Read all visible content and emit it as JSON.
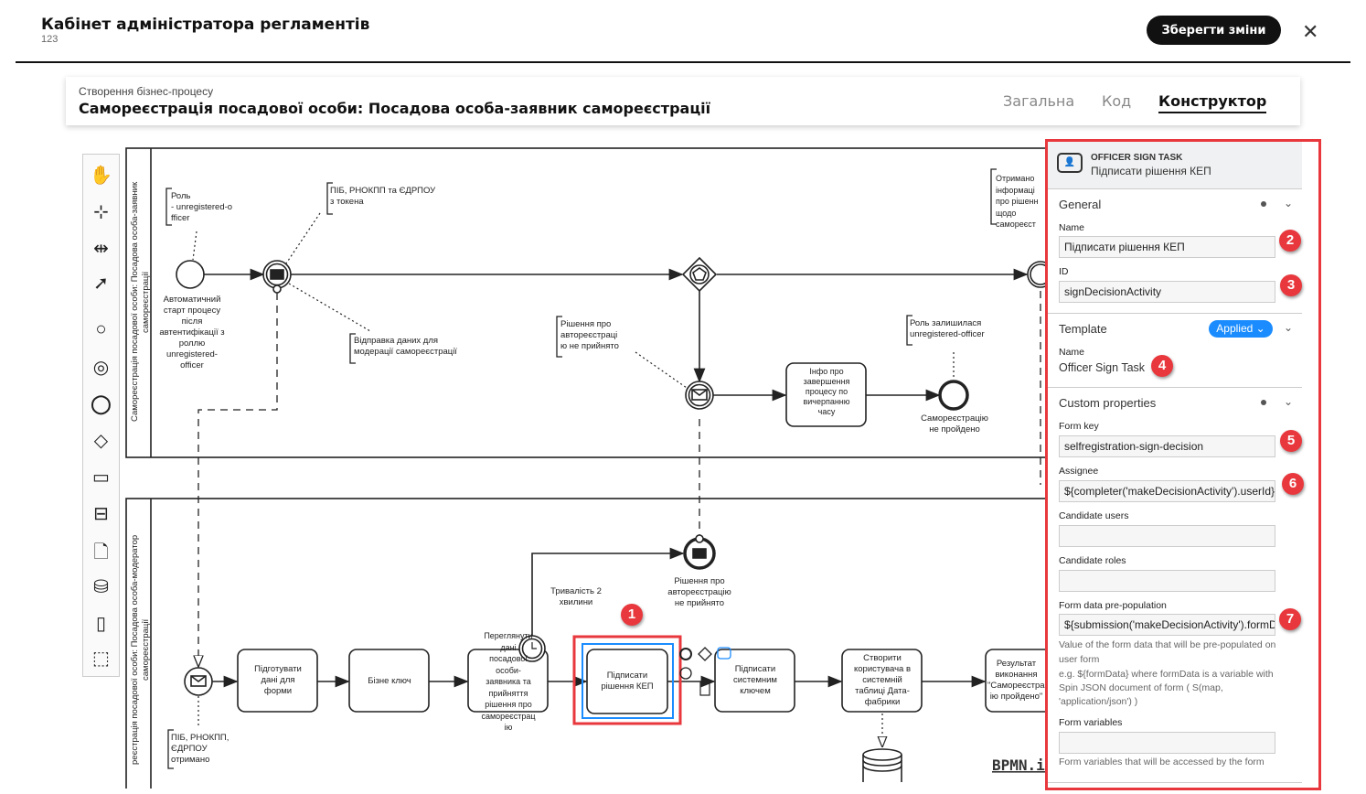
{
  "header": {
    "title": "Кабінет адміністратора регламентів",
    "subtitle": "123",
    "save_label": "Зберегти зміни",
    "close_icon": "close-icon"
  },
  "card": {
    "breadcrumb": "Створення бізнес-процесу",
    "title": "Самореєстрація посадової особи: Посадова особа-заявник самореєстрації",
    "tabs": [
      {
        "label": "Загальна"
      },
      {
        "label": "Код"
      },
      {
        "label": "Конструктор",
        "active": true
      }
    ]
  },
  "palette": [
    "hand-tool-icon",
    "lasso-tool-icon",
    "space-tool-icon",
    "connect-tool-icon",
    "start-event-icon",
    "intermediate-event-icon",
    "end-event-icon",
    "gateway-icon",
    "task-icon",
    "subprocess-icon",
    "data-object-icon",
    "data-store-icon",
    "pool-icon",
    "group-icon"
  ],
  "diagram": {
    "pool1": "Самореєстрація посадової особи: Посадова особа-заявник\nсамореєстрації",
    "pool2": "реєстрація посадової особи: Посадова особа-модератор\nсамореєстрації",
    "ann_role": "Роль\n- unregistered-o\nfficer",
    "ann_pib_token": "ПІБ, РНОКПП та ЄДРПОУ\nз токена",
    "start_label": "Автоматичний\nстарт процесу\nпісля\nавтентифікації з\nроллю\nunregistered-\nofficer",
    "ann_send": "Відправка даних для\nмодерації самореєстрації",
    "ann_decision": "Рішення про\nавтореєстраці\nю не прийнято",
    "task_info": "Інфо про\nзавершення\nпроцесу по\nвичерпанню\nчасу",
    "ann_role_left": "Роль залишилася\nunregistered-officer",
    "end_label": "Самореєстрацію\nне пройдено",
    "ann_received": "Отримано\nінформаці\nпро рішенн\nщодо\nсамореєст",
    "ann_pib_received": "ПІБ, РНОКПП,\nЄДРПОУ\nотримано",
    "task_prepare": "Підготувати\nдані для\nформи",
    "task_bkey": "Бізне ключ",
    "task_review": "Переглянути\nдані\nпосадової\nособи-\nзаявника та\nприйняття\nрішення про\nсамореєстрац\nію",
    "timer_label": "Тривалість 2\nхвилини",
    "msg_end_label": "Рішення про\nавтореєстрацію\nне прийнято",
    "task_sign": "Підписати\nрішення КЕП",
    "task_sys_sign": "Підписати\nсистемним\nключем",
    "task_create_user": "Створити\nкористувача в\nсистемній\nтаблиці Дата-\nфабрики",
    "task_result": "Результат\nвиконання\n\"Самореєстрац\nію пройдено\"",
    "watermark": "BPMN.iO"
  },
  "badges": [
    "1",
    "2",
    "3",
    "4",
    "5",
    "6",
    "7"
  ],
  "panel": {
    "type": "OFFICER SIGN TASK",
    "name": "Підписати рішення КЕП",
    "general": "General",
    "name_label": "Name",
    "name_value": "Підписати рішення КЕП",
    "id_label": "ID",
    "id_value": "signDecisionActivity",
    "template": "Template",
    "applied": "Applied",
    "tpl_name_label": "Name",
    "tpl_name_value": "Officer Sign Task",
    "custom": "Custom properties",
    "form_key_label": "Form key",
    "form_key_value": "selfregistration-sign-decision",
    "assignee_label": "Assignee",
    "assignee_value": "${completer('makeDecisionActivity').userId}",
    "cand_users_label": "Candidate users",
    "cand_users_value": "",
    "cand_roles_label": "Candidate roles",
    "cand_roles_value": "",
    "prepop_label": "Form data pre-population",
    "prepop_value": "${submission('makeDecisionActivity').formData}",
    "prepop_hint": "Value of the form data that will be pre-populated on user form",
    "prepop_hint2": "e.g. ${formData} where formData is a variable with Spin JSON document of form ( S(map, 'application/json') )",
    "formvars_label": "Form variables",
    "formvars_value": "",
    "formvars_hint": "Form variables that will be accessed by the form"
  },
  "colors": {
    "accent": "#1a8cff",
    "highlight": "#e8383d",
    "primary": "#111111"
  }
}
